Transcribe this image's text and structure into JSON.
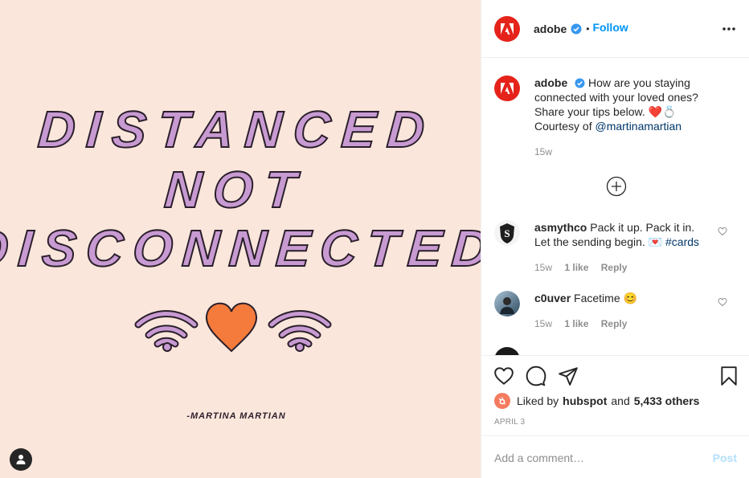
{
  "image": {
    "line1": "DISTANCED",
    "line2": "NOT",
    "line3": "DISCONNECTED",
    "signature": "-MARTINA MARTIAN",
    "colors": {
      "background": "#fbe6dc",
      "letters": "#c89ad2",
      "heart": "#f47b3c"
    }
  },
  "header": {
    "username": "adobe",
    "separator": "•",
    "follow_label": "Follow",
    "more_icon": "more-horizontal-icon"
  },
  "caption": {
    "username": "adobe",
    "text": "How are you staying connected with your loved ones? Share your tips below. ❤️💍",
    "credit_prefix": "Courtesy of",
    "mention": "@martinamartian",
    "time": "15w"
  },
  "comments": [
    {
      "username": "asmythco",
      "text": "Pack it up. Pack it in. Let the sending begin. 💌",
      "hashtag": "#cards",
      "time": "15w",
      "likes": "1 like",
      "reply": "Reply"
    },
    {
      "username": "c0uver",
      "text": "Facetime 😊",
      "time": "15w",
      "likes": "1 like",
      "reply": "Reply"
    }
  ],
  "likes": {
    "prefix": "Liked by",
    "user": "hubspot",
    "and": "and",
    "others": "5,433 others"
  },
  "date": "APRIL 3",
  "add_comment": {
    "placeholder": "Add a comment…",
    "post_label": "Post"
  },
  "accent": "#0095f6"
}
